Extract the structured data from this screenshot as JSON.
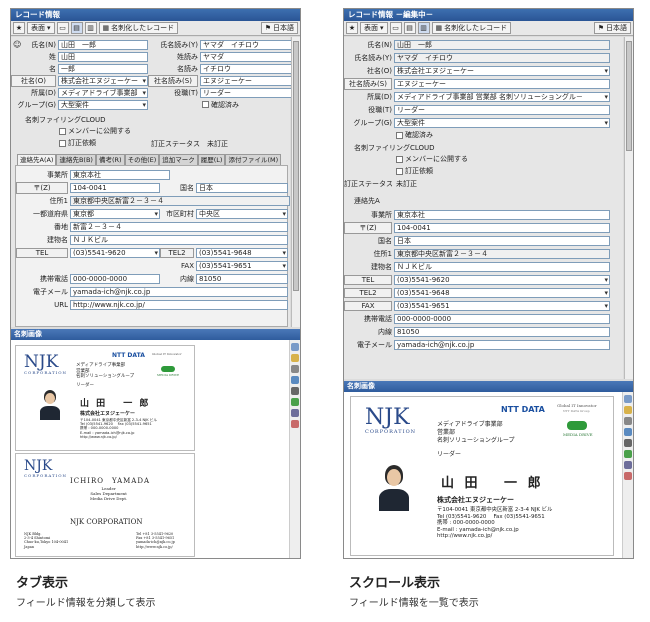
{
  "left": {
    "title": "レコード情報",
    "toolbar": {
      "view": "表面",
      "saved": "名刺化したレコード",
      "lang": "日本語"
    },
    "fields": {
      "name_label": "氏名(N)",
      "name": "山田　一郎",
      "kana_label": "氏名読み(Y)",
      "kana": "ヤマダ　イチロウ",
      "sei_label": "姓",
      "sei": "山田",
      "sei_kana_label": "姓読み",
      "sei_kana": "ヤマダ",
      "mei_label": "名",
      "mei": "一郎",
      "mei_kana_label": "名読み",
      "mei_kana": "イチロウ",
      "company_label": "社名(O)",
      "company": "株式会社エヌジェーケー",
      "company_kana_label": "社名読み(S)",
      "company_kana": "エヌジェーケー",
      "dept_label": "所属(D)",
      "dept": "メディアドライブ事業部",
      "title_label": "役職(T)",
      "title": "リーダー",
      "group_label": "グループ(G)",
      "group": "大型案件",
      "confirm": "確認済み",
      "filing_label": "名刺ファイリングCLOUD",
      "publish": "メンバーに公開する",
      "correct_req": "訂正依頼",
      "correct_status_label": "訂正ステータス",
      "correct_status": "未訂正"
    },
    "tabs": [
      "連絡先A(A)",
      "連絡先B(B)",
      "備考(R)",
      "その他(E)",
      "追加マーク",
      "履歴(L)",
      "添付ファイル(M)"
    ],
    "contact": {
      "office_label": "事業所",
      "office": "東京本社",
      "zip_label": "〒(Z)",
      "zip": "104-0041",
      "country_label": "国名",
      "country": "日本",
      "addr1_label": "住所1",
      "addr1": "東京都中央区新富２－３－４",
      "pref_label": "一都道府県",
      "pref": "東京都",
      "city_label": "市区町村",
      "city": "中央区",
      "banchi_label": "番地",
      "banchi": "新富２－３－４",
      "bldg_label": "建物名",
      "bldg": "ＮＪＫビル",
      "tel_label": "TEL",
      "tel": "(03)5541-9620",
      "tel2_label": "TEL2",
      "tel2": "(03)5541-9648",
      "fax_label": "FAX",
      "fax": "(03)5541-9651",
      "mobile_label": "携帯電話",
      "mobile": "000-0000-0000",
      "ext_label": "内線",
      "ext": "81050",
      "email_label": "電子メール",
      "email": "yamada-ich@njk.co.jp",
      "url_label": "URL",
      "url": "http://www.njk.co.jp/"
    },
    "image_title": "名刺画像",
    "caption": "タブ表示",
    "subcaption": "フィールド情報を分類して表示"
  },
  "right": {
    "title": "レコード情報 －編集中－",
    "toolbar": {
      "view": "表面",
      "saved": "名刺化したレコード",
      "lang": "日本語"
    },
    "fields": {
      "name_label": "氏名(N)",
      "name": "山田　一郎",
      "kana_label": "氏名読み(Y)",
      "kana": "ヤマダ　イチロウ",
      "company_label": "社名(O)",
      "company": "株式会社エヌジェーケー",
      "company_kana_label": "社名読み(S)",
      "company_kana": "エヌジェーケー",
      "dept_label": "所属(D)",
      "dept": "メディアドライブ事業部 営業部 名刺ソリューショングル－",
      "title_label": "役職(T)",
      "title": "リーダー",
      "group_label": "グループ(G)",
      "group": "大型案件",
      "confirm": "確認済み",
      "filing_label": "名刺ファイリングCLOUD",
      "publish": "メンバーに公開する",
      "correct_req": "訂正依頼",
      "correct_status_label": "訂正ステータス",
      "correct_status": "未訂正",
      "contact_label": "連絡先A",
      "office_label": "事業所",
      "office": "東京本社",
      "zip_label": "〒(Z)",
      "zip": "104-0041",
      "country_label": "国名",
      "country": "日本",
      "addr1_label": "住所1",
      "addr1": "東京都中央区新富２－３－４",
      "bldg_label": "建物名",
      "bldg": "ＮＪＫビル",
      "tel_label": "TEL",
      "tel": "(03)5541-9620",
      "tel2_label": "TEL2",
      "tel2": "(03)5541-9648",
      "fax_label": "FAX",
      "fax": "(03)5541-9651",
      "mobile_label": "携帯電話",
      "mobile": "000-0000-0000",
      "ext_label": "内線",
      "ext": "81050",
      "email_label": "電子メール",
      "email": "yamada-ich@njk.co.jp"
    },
    "image_title": "名刺画像",
    "caption": "スクロール表示",
    "subcaption": "フィールド情報を一覧で表示"
  },
  "card": {
    "logo": "NJK",
    "logo_sub": "CORPORATION",
    "nttdata": "NTT DATA",
    "nttdata_sub": "Global IT Innovator",
    "nttdata_sub2": "NTT DATA Group",
    "media": "MEDIA DRIVE",
    "dept1": "メディアドライブ事業部",
    "dept2": "営業部",
    "dept3": "名刺ソリューショングループ",
    "role": "リーダー",
    "name": "山 田　 一 郎",
    "company": "株式会社エヌジェーケー",
    "addr": "〒104-0041 東京都中央区新富 2-3-4 NJK ビル",
    "telfax": "Tel (03)5541-9620　 Fax (03)5541-9651",
    "mobile": "携帯 : 000-0000-0000",
    "email": "E-mail : yamada-ich@njk.co.jp",
    "url": "http://www.njk.co.jp/",
    "en_name": "ICHIRO　YAMADA",
    "en_role": "Leader",
    "en_dept1": "Sales Department",
    "en_dept2": "Media Drive Dept.",
    "en_corp": "NJK CORPORATION",
    "en_addr1": "NJK Bldg.",
    "en_addr2": "2-3-4 Shintomi",
    "en_addr3": "Chuo-ku,Tokyo 104-0041",
    "en_addr4": "Japan",
    "en_tel": "Tel +81 3-5541-9620",
    "en_fax": "Fax +81 3-5541-9651",
    "en_email": "yamada-ich@njk.co.jp",
    "en_url": "http://www.njk.co.jp/"
  }
}
